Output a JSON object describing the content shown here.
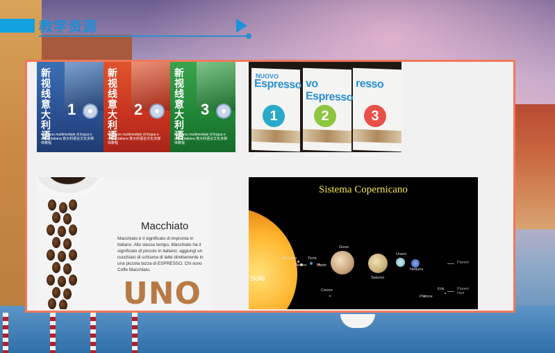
{
  "header": {
    "title": "教学资源"
  },
  "resources": [
    {
      "id": "books",
      "items": [
        {
          "title": "新视线意大利语",
          "number": "1",
          "footer": "Un corso multimediale di lingua e civiltà italiana  意大利语言文化多媒体教程"
        },
        {
          "title": "新视线意大利语",
          "number": "2",
          "footer": "Un corso multimediale di lingua e civiltà italiana  意大利语言文化多媒体教程"
        },
        {
          "title": "新视线意大利语",
          "number": "3",
          "footer": "Un corso multimediale di lingua e civiltà italiana  意大利语言文化多媒体教程"
        }
      ]
    },
    {
      "id": "espresso",
      "items": [
        {
          "prefix": "NUOVO",
          "brand": "Espresso",
          "number": "1"
        },
        {
          "prefix": "",
          "brand": "vo Espresso",
          "number": "2"
        },
        {
          "prefix": "",
          "brand": "resso",
          "number": "3"
        }
      ]
    },
    {
      "id": "macchiato",
      "title": "Macchiato",
      "text": "Macchiato è il significato di impronta in italiano. Allo stesso tempo, Macchiato ha il significato di piccolo in italiano: aggiungi un cucchiaio di schiuma di latte direttamente in una piccola tazza di ESPRESSO. Chi sono Coffe Macchiato.",
      "brand": "UNO"
    },
    {
      "id": "solar",
      "title": "Sistema Copernicano",
      "sun_label": "Sole",
      "planets": [
        "Mercurio",
        "Venere",
        "Terra",
        "Marte",
        "Giove",
        "Saturno",
        "Urano",
        "Nettuno",
        "Cerere",
        "Plutone",
        "Eris"
      ],
      "legend": [
        "Pianeti",
        "Pianeti nani"
      ]
    }
  ],
  "colors": {
    "accent": "#1d8fd6",
    "panel_border": "#f0785a",
    "uno": "#b77a46",
    "solar_title": "#f5e84a"
  }
}
